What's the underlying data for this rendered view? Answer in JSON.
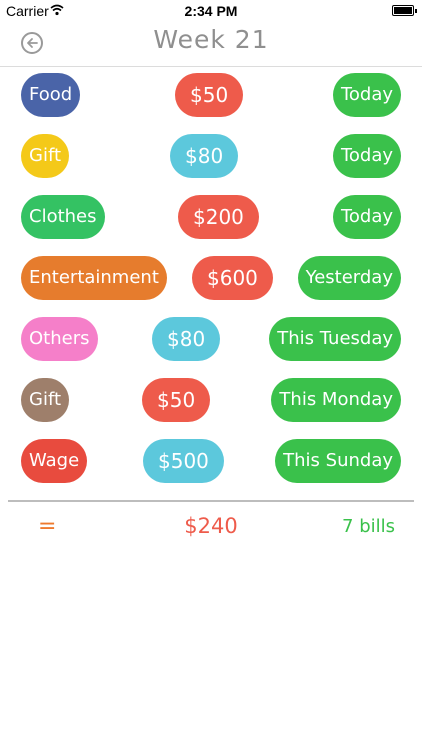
{
  "status_bar": {
    "carrier": "Carrier",
    "time": "2:34 PM"
  },
  "nav": {
    "title": "Week 21",
    "back_icon": "back-arrow-icon"
  },
  "bills": [
    {
      "category": "Food",
      "category_color": "#4a64a8",
      "amount": "$50",
      "amount_color": "#ee5b4b",
      "when": "Today"
    },
    {
      "category": "Gift",
      "category_color": "#f4c919",
      "amount": "$80",
      "amount_color": "#5cc8dc",
      "when": "Today"
    },
    {
      "category": "Clothes",
      "category_color": "#34c263",
      "amount": "$200",
      "amount_color": "#ee5b4b",
      "when": "Today"
    },
    {
      "category": "Entertainment",
      "category_color": "#e67c2d",
      "amount": "$600",
      "amount_color": "#ee5b4b",
      "when": "Yesterday"
    },
    {
      "category": "Others",
      "category_color": "#f57fc9",
      "amount": "$80",
      "amount_color": "#5cc8dc",
      "when": "This Tuesday"
    },
    {
      "category": "Gift",
      "category_color": "#9e7f6b",
      "amount": "$50",
      "amount_color": "#ee5b4b",
      "when": "This Monday"
    },
    {
      "category": "Wage",
      "category_color": "#e84b3e",
      "amount": "$500",
      "amount_color": "#5cc8dc",
      "when": "This Sunday"
    }
  ],
  "summary": {
    "equals": "=",
    "total": "$240",
    "count": "7 bills"
  }
}
